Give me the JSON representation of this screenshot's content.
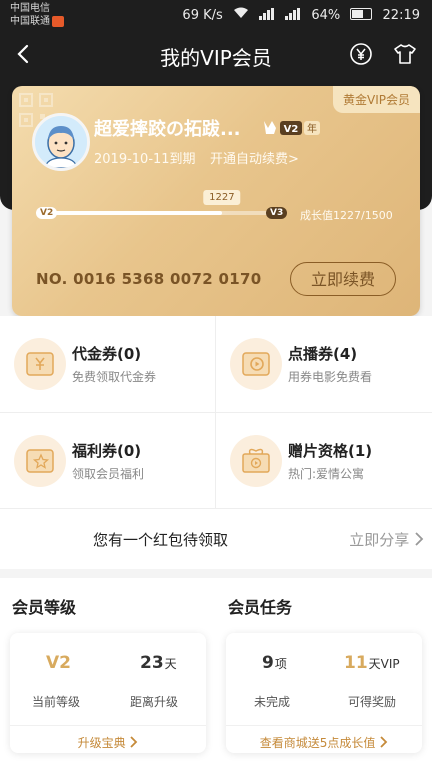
{
  "status_bar": {
    "carrier1": "中国电信",
    "carrier2": "中国联通",
    "speed": "69 K/s",
    "battery": "64%",
    "time": "22:19"
  },
  "nav": {
    "title": "我的VIP会员",
    "back_icon": "chevron-left-icon",
    "yen_icon": "yen-icon",
    "shirt_icon": "tshirt-icon"
  },
  "card": {
    "tier": "黄金VIP会员",
    "username": "超爱摔跤の拓跋...",
    "level": "V2",
    "level_suffix": "年",
    "expiry": "2019-10-11到期",
    "auto_renew": "开通自动续费>",
    "progress_current": 1227,
    "progress_max": 1500,
    "progress_fraction": 0.76,
    "level_from": "V2",
    "level_to": "V3",
    "growth_text": "成长值1227/1500",
    "number": "NO. 0016 5368 0072 0170",
    "renew_button": "立即续费"
  },
  "coupons": [
    {
      "title": "代金券(0)",
      "desc": "免费领取代金券",
      "icon": "yen-ticket-icon"
    },
    {
      "title": "点播券(4)",
      "desc": "用券电影免费看",
      "icon": "play-ticket-icon"
    },
    {
      "title": "福利券(0)",
      "desc": "领取会员福利",
      "icon": "star-ticket-icon"
    },
    {
      "title": "赠片资格(1)",
      "desc": "热门:爱情公寓",
      "icon": "gift-icon"
    }
  ],
  "red_packet": {
    "text": "您有一个红包待领取",
    "share": "立即分享"
  },
  "level_section": {
    "title": "会员等级",
    "current_value": "V2",
    "current_label": "当前等级",
    "days_value": "23",
    "days_unit": "天",
    "days_label": "距离升级",
    "link": "升级宝典"
  },
  "task_section": {
    "title": "会员任务",
    "todo_value": "9",
    "todo_unit": "项",
    "todo_label": "未完成",
    "reward_value": "11",
    "reward_unit": "天VIP",
    "reward_label": "可得奖励",
    "link": "查看商城送5点成长值"
  },
  "colors": {
    "gold": "#e3bd83",
    "accent": "#c58a3a",
    "dark": "#1e1e1e"
  }
}
